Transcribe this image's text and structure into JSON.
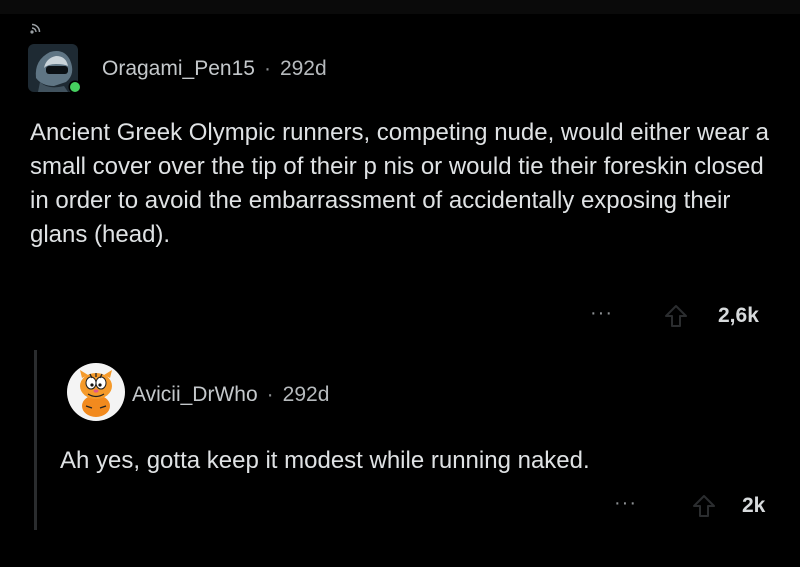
{
  "comment": {
    "username": "Oragami_Pen15",
    "separator": "·",
    "age": "292d",
    "body": "Ancient Greek Olympic runners, competing nude, would either wear a small cover over the tip of their p  nis or would tie their foreskin closed in order to avoid the embarrassment of accidentally exposing their glans (head).",
    "more_label": "···",
    "upvote_icon": "upvote-arrow-icon",
    "votes": "2,6k",
    "online_status_color": "#46d160"
  },
  "reply": {
    "username": "Avicii_DrWho",
    "separator": "·",
    "age": "292d",
    "body": "Ah yes, gotta keep it modest while running naked.",
    "more_label": "···",
    "upvote_icon": "upvote-arrow-icon",
    "votes": "2k"
  },
  "colors": {
    "background": "#000000",
    "text": "#dfe2e4",
    "muted": "#8c8f92",
    "thread_line": "#2a2c2e"
  }
}
